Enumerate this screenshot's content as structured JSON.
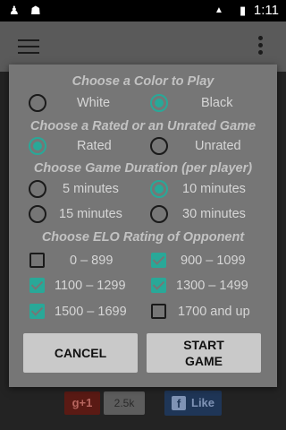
{
  "status_bar": {
    "time": "1:11",
    "network": "LTE"
  },
  "dialog": {
    "color_section": {
      "heading": "Choose a Color to Play",
      "options": [
        {
          "label": "White",
          "selected": false
        },
        {
          "label": "Black",
          "selected": true
        }
      ]
    },
    "rated_section": {
      "heading": "Choose a Rated or an Unrated Game",
      "options": [
        {
          "label": "Rated",
          "selected": true
        },
        {
          "label": "Unrated",
          "selected": false
        }
      ]
    },
    "duration_section": {
      "heading": "Choose Game Duration (per player)",
      "options": [
        {
          "label": "5 minutes",
          "selected": false
        },
        {
          "label": "10 minutes",
          "selected": true
        },
        {
          "label": "15 minutes",
          "selected": false
        },
        {
          "label": "30 minutes",
          "selected": false
        }
      ]
    },
    "elo_section": {
      "heading": "Choose ELO Rating of Opponent",
      "options": [
        {
          "label": "0 – 899",
          "checked": false
        },
        {
          "label": "900 – 1099",
          "checked": true
        },
        {
          "label": "1100 – 1299",
          "checked": true
        },
        {
          "label": "1300 – 1499",
          "checked": true
        },
        {
          "label": "1500 – 1699",
          "checked": true
        },
        {
          "label": "1700 and up",
          "checked": false
        }
      ]
    },
    "buttons": {
      "cancel": "CANCEL",
      "start": "START\nGAME"
    }
  },
  "social": {
    "gplus_label": "g+1",
    "gplus_count": "2.5k",
    "fb_label": "Like"
  },
  "colors": {
    "accent": "#29a898",
    "dialog_bg": "#767676",
    "button_bg": "#c9c9c9"
  }
}
